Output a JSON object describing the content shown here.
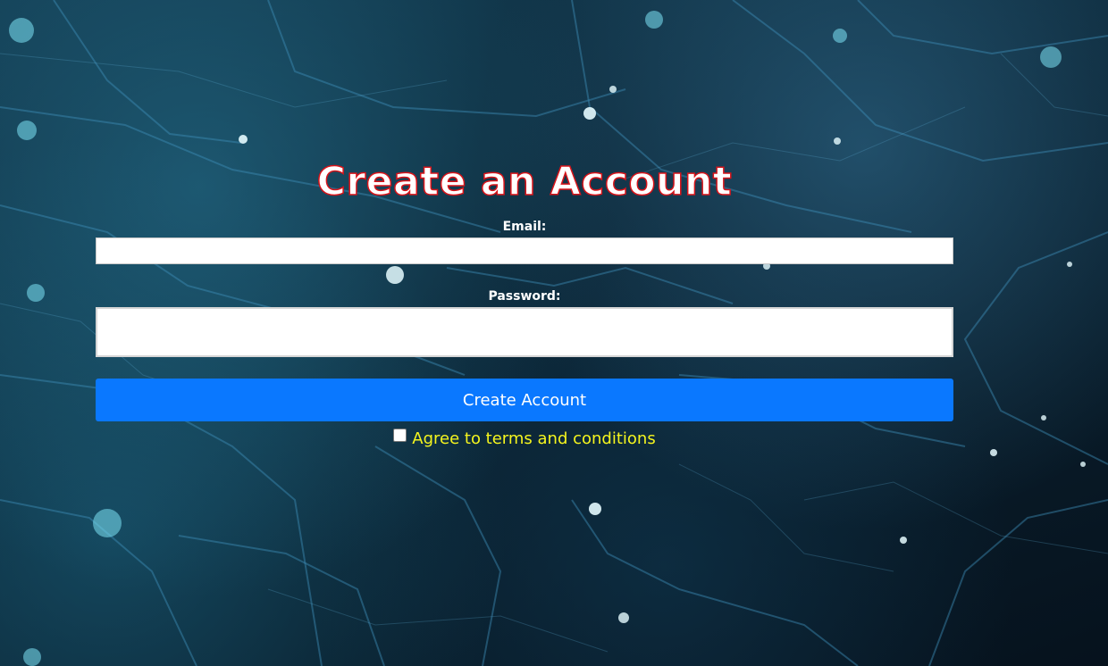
{
  "form": {
    "title": "Create an Account",
    "email_label": "Email:",
    "email_value": "",
    "password_label": "Password:",
    "password_value": "",
    "submit_label": "Create Account",
    "terms_label": "Agree to terms and conditions",
    "terms_checked": false
  },
  "colors": {
    "title_fill": "#ffffff",
    "title_outline": "#d8141a",
    "button_bg": "#0a78ff",
    "terms_text": "#f5f51e",
    "background": "#0b2434"
  },
  "background_image": {
    "icon": "circuit-board-pattern"
  }
}
